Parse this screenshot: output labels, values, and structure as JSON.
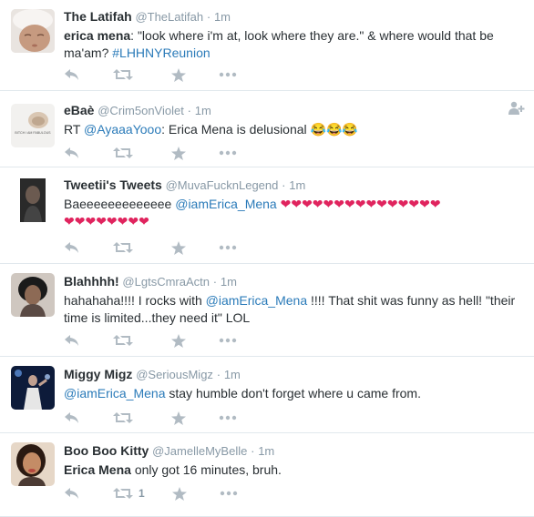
{
  "tweets": [
    {
      "name": "The Latifah",
      "handle": "@TheLatifah",
      "time": "1m",
      "text_bold": "erica mena",
      "text_1": ": \"look where i'm at, look where they are.\" & where would that be ma'am? ",
      "hashtag": "#LHHNYReunion",
      "retweet_count": ""
    },
    {
      "name": "eBaè",
      "handle": "@Crim5onViolet",
      "time": "1m",
      "rt_prefix": "RT ",
      "mention": "@AyaaaYooo",
      "text_1": ": Erica Mena is delusional ",
      "emoji": "😂😂😂",
      "avatar_caption": "BITCH I AM FABULOUS",
      "retweet_count": ""
    },
    {
      "name": "Tweetii's Tweets",
      "handle": "@MuvaFucknLegend",
      "time": "1m",
      "text_1": "Baeeeeeeeeeeeee ",
      "mention": "@iamErica_Mena",
      "hearts_line1": "❤❤❤❤❤❤❤❤❤❤❤❤❤❤❤",
      "hearts_line2": "❤❤❤❤❤❤❤❤",
      "retweet_count": ""
    },
    {
      "name": "Blahhhh!",
      "handle": "@LgtsCmraActn",
      "time": "1m",
      "text_1": "hahahaha!!!! I rocks with ",
      "mention": "@iamErica_Mena",
      "text_2": " !!!! That shit was funny as hell! \"their time is limited...they need it\" LOL",
      "retweet_count": ""
    },
    {
      "name": "Miggy Migz",
      "handle": "@SeriousMigz",
      "time": "1m",
      "mention": "@iamErica_Mena",
      "text_2": " stay humble don't forget where u came from.",
      "retweet_count": ""
    },
    {
      "name": "Boo Boo Kitty",
      "handle": "@JamelleMyBelle",
      "time": "1m",
      "text_bold": "Erica Mena",
      "text_1": " only got 16 minutes, bruh.",
      "retweet_count": "1"
    }
  ],
  "separator": "·",
  "icons": {
    "reply": "reply-icon",
    "retweet": "retweet-icon",
    "favorite": "star-icon",
    "more": "more-icon",
    "follow": "follow-icon"
  },
  "colors": {
    "link": "#2b7bb9",
    "muted": "#8899a6",
    "action": "#b1bbc3",
    "heart": "#e0245e",
    "border": "#e1e8ed"
  }
}
